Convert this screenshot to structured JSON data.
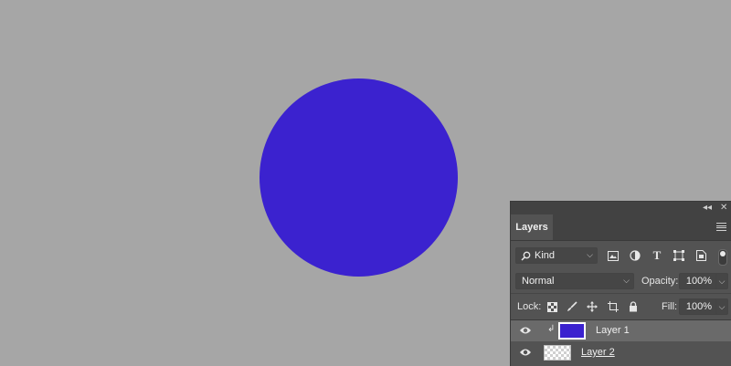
{
  "canvas": {
    "background": "#a6a6a6",
    "shape_color": "#3b22cf"
  },
  "panel": {
    "tab_label": "Layers",
    "kind_filter": "Kind",
    "blend_mode": "Normal",
    "opacity_label": "Opacity:",
    "opacity_value": "100%",
    "lock_label": "Lock:",
    "fill_label": "Fill:",
    "fill_value": "100%",
    "filter_icons": [
      "image-filter-icon",
      "adjustment-filter-icon",
      "type-filter-icon",
      "shape-filter-icon",
      "smart-object-filter-icon"
    ],
    "lock_icons": [
      "lock-transparent-pixels-icon",
      "lock-image-pixels-icon",
      "lock-position-icon",
      "lock-artboard-icon",
      "lock-all-icon"
    ]
  },
  "layers": [
    {
      "name": "Layer 1",
      "selected": true,
      "thumbnail": "blue-fill",
      "clipped": true
    },
    {
      "name": "Layer 2",
      "selected": false,
      "thumbnail": "transparent"
    }
  ]
}
